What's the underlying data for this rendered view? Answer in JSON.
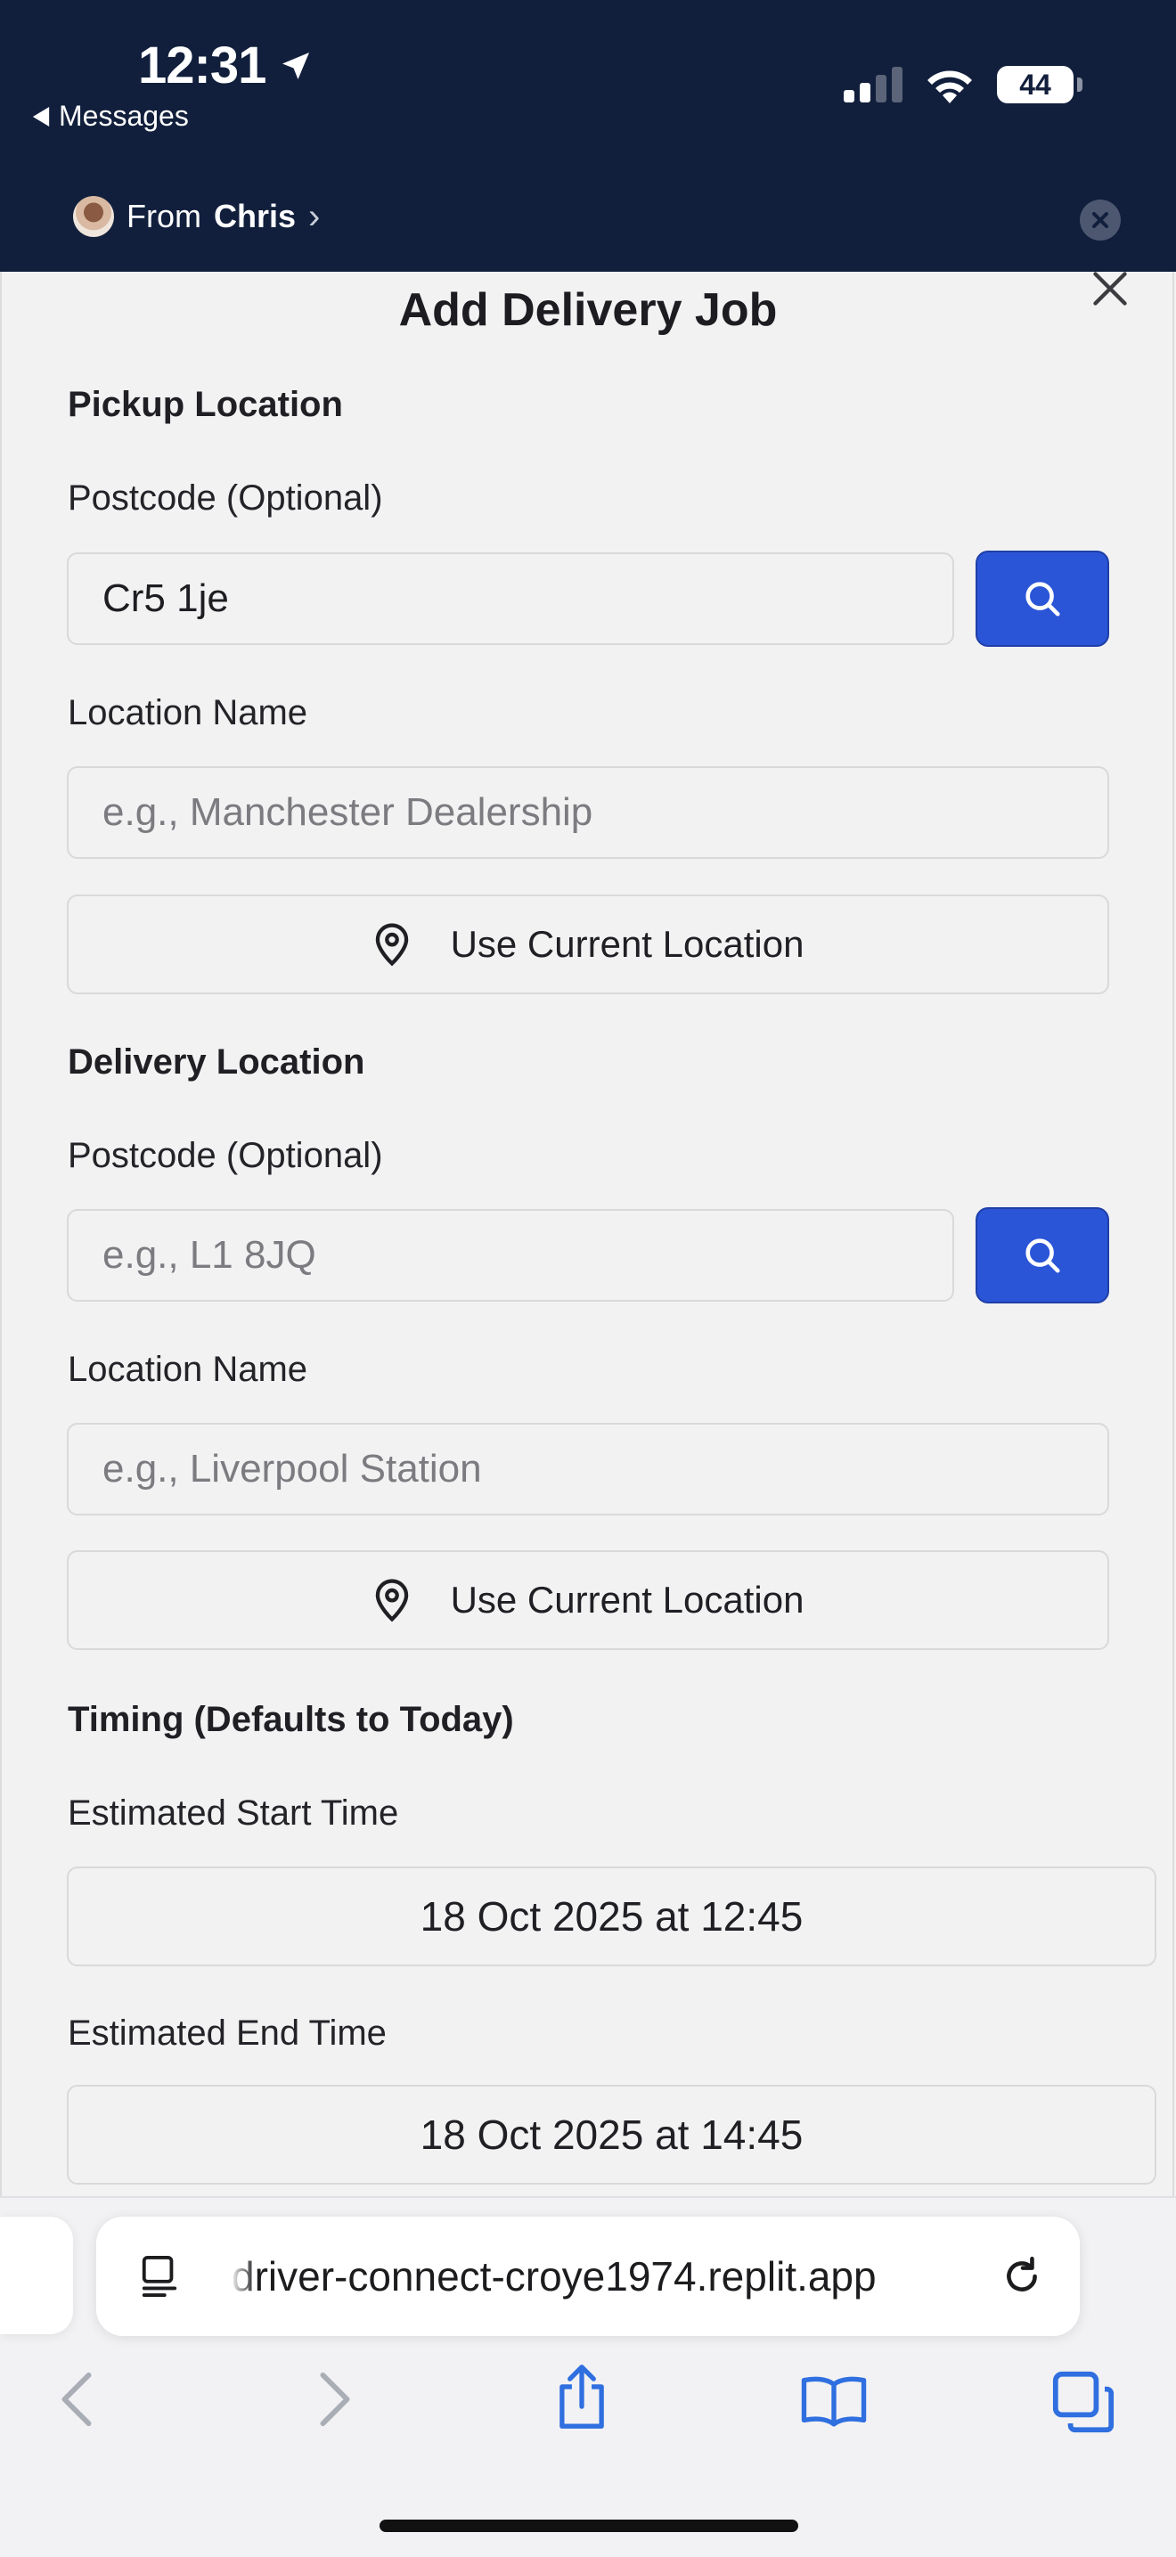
{
  "status_bar": {
    "time": "12:31",
    "back_app": "Messages",
    "battery": "44"
  },
  "banner": {
    "from_prefix": "From",
    "from_name": "Chris",
    "chevron": "›"
  },
  "modal": {
    "title": "Add Delivery Job",
    "pickup": {
      "section": "Pickup Location",
      "postcode_label": "Postcode (Optional)",
      "postcode_value": "Cr5 1je",
      "location_label": "Location Name",
      "location_placeholder": "e.g., Manchester Dealership",
      "use_current": "Use Current Location"
    },
    "delivery": {
      "section": "Delivery Location",
      "postcode_label": "Postcode (Optional)",
      "postcode_placeholder": "e.g., L1 8JQ",
      "location_label": "Location Name",
      "location_placeholder": "e.g., Liverpool Station",
      "use_current": "Use Current Location"
    },
    "timing": {
      "section": "Timing (Defaults to Today)",
      "start_label": "Estimated Start Time",
      "start_value": "18 Oct 2025 at 12:45",
      "end_label": "Estimated End Time",
      "end_value": "18 Oct 2025 at 14:45"
    }
  },
  "browser": {
    "url": "driver-connect-croye1974.replit.app"
  },
  "colors": {
    "banner_bg": "#111f3c",
    "accent_blue": "#2b55d7",
    "page_bg": "#f2f2f3"
  },
  "icons": [
    "location-arrow-icon",
    "signal-icon",
    "wifi-icon",
    "battery-icon",
    "close-icon",
    "search-icon",
    "map-pin-icon",
    "reader-icon",
    "reload-icon",
    "back-arrow-icon",
    "forward-arrow-icon",
    "share-icon",
    "bookmarks-icon",
    "tabs-icon"
  ]
}
